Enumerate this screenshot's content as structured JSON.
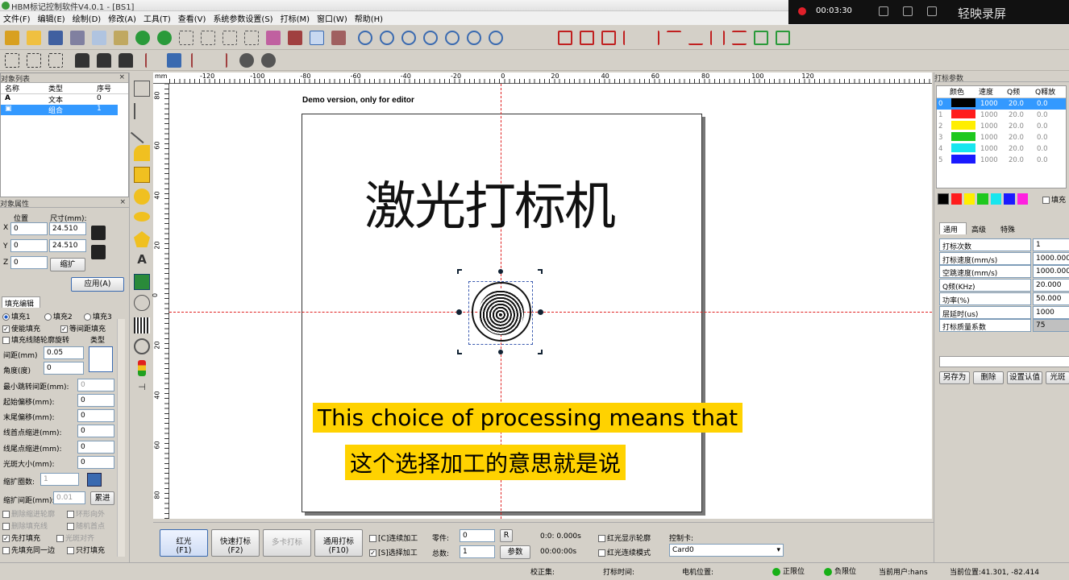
{
  "app": {
    "title": "HBM标记控制软件V4.0.1 - [BS1]"
  },
  "menu": [
    "文件(F)",
    "编辑(E)",
    "绘制(D)",
    "修改(A)",
    "工具(T)",
    "查看(V)",
    "系统参数设置(S)",
    "打标(M)",
    "窗口(W)",
    "帮助(H)"
  ],
  "recorder": {
    "time": "00:03:30",
    "brand": "轻映录屏"
  },
  "object_list": {
    "title": "对象列表",
    "headers": [
      "名称",
      "类型",
      "序号"
    ],
    "rows": [
      {
        "type": "文本",
        "index": "0"
      },
      {
        "type": "组合",
        "index": "1"
      }
    ]
  },
  "object_props": {
    "title": "对象属性",
    "pos_label": "位置",
    "size_label": "尺寸(mm):",
    "x_label": "X",
    "y_label": "Y",
    "z_label": "Z",
    "x": "0",
    "y": "0",
    "z": "0",
    "w": "24.510",
    "h": "24.510",
    "scale_btn": "缩扩",
    "apply_btn": "应用(A)"
  },
  "fill": {
    "tab": "填充编辑",
    "radio1": "填充1",
    "radio2": "填充2",
    "radio3": "填充3",
    "enable": "使能填充",
    "equal": "等间距填充",
    "follow": "填充线随轮廓旋转",
    "type_label": "类型",
    "spacing_label": "间距(mm)",
    "spacing": "0.05",
    "angle_label": "角度(度)",
    "angle": "0",
    "min_jump_label": "最小跳转间距(mm):",
    "min_jump": "0",
    "start_off_label": "起始偏移(mm):",
    "start_off": "0",
    "end_off_label": "末尾偏移(mm):",
    "end_off": "0",
    "line_head_label": "线首点缩进(mm):",
    "line_head": "0",
    "line_tail_label": "线尾点缩进(mm):",
    "line_tail": "0",
    "spot_label": "光斑大小(mm):",
    "spot": "0",
    "expand_count_label": "缩扩圈数:",
    "expand_count": "1",
    "expand_gap_label": "缩扩间距(mm):",
    "expand_gap": "0.01",
    "accum_btn": "累进",
    "del_contour": "删除缩进轮廓",
    "ring_out": "环形向外",
    "del_fill": "删除填充线",
    "random_start": "随机首点",
    "first_fill": "先打填充",
    "spot_align": "光斑对齐",
    "fill_same_side": "先填充同一边",
    "fill_only": "只打填充"
  },
  "ruler": {
    "unit": "mm",
    "h_ticks": [
      "-120",
      "-100",
      "-80",
      "-60",
      "-40",
      "-20",
      "0",
      "20",
      "40",
      "60",
      "80",
      "100",
      "120"
    ],
    "v_ticks": [
      "80",
      "60",
      "40",
      "20",
      "0",
      "20",
      "40",
      "60",
      "80"
    ]
  },
  "canvas": {
    "demo_text": "Demo version, only for editor",
    "big_text": "激光打标机"
  },
  "subtitle": {
    "en": "This choice of processing means that",
    "zh": "这个选择加工的意思就是说"
  },
  "params": {
    "title": "打标参数",
    "headers": [
      "颜色",
      "速度",
      "Q频",
      "Q释放"
    ],
    "rows": [
      {
        "id": "0",
        "color": "#000000",
        "speed": "1000",
        "q": "20.0",
        "qr": "0.0"
      },
      {
        "id": "1",
        "color": "#ff1c1c",
        "speed": "1000",
        "q": "20.0",
        "qr": "0.0"
      },
      {
        "id": "2",
        "color": "#ffee00",
        "speed": "1000",
        "q": "20.0",
        "qr": "0.0"
      },
      {
        "id": "3",
        "color": "#1ec81e",
        "speed": "1000",
        "q": "20.0",
        "qr": "0.0"
      },
      {
        "id": "4",
        "color": "#17e6ee",
        "speed": "1000",
        "q": "20.0",
        "qr": "0.0"
      },
      {
        "id": "5",
        "color": "#1a1aff",
        "speed": "1000",
        "q": "20.0",
        "qr": "0.0"
      }
    ],
    "fill_check": "填充",
    "tabs": [
      "通用",
      "高级",
      "特殊"
    ],
    "fields": [
      {
        "label": "打标次数",
        "value": "1"
      },
      {
        "label": "打标速度(mm/s)",
        "value": "1000.000"
      },
      {
        "label": "空跳速度(mm/s)",
        "value": "1000.000"
      },
      {
        "label": "Q频(KHz)",
        "value": "20.000"
      },
      {
        "label": "功率(%)",
        "value": "50.000"
      },
      {
        "label": "层延时(us)",
        "value": "1000"
      },
      {
        "label": "打标质量系数",
        "value": "75"
      }
    ],
    "buttons": [
      "另存为",
      "删除",
      "设置认值",
      "光斑"
    ]
  },
  "bottom": {
    "red": "红光",
    "red_key": "(F1)",
    "fast": "快速打标",
    "fast_key": "(F2)",
    "multi": "多卡打标",
    "general": "通用打标",
    "general_key": "(F10)",
    "continuous": "[C]连续加工",
    "select": "[S]选择加工",
    "parts_label": "零件:",
    "parts": "0",
    "total_label": "总数:",
    "total": "1",
    "r_btn": "R",
    "param_btn": "参数",
    "time1": "0:0: 0.000s",
    "time2": "00:00:00s",
    "red_contour": "红光显示轮廓",
    "red_cont_mode": "红光连续模式",
    "card_label": "控制卡:",
    "card": "Card0"
  },
  "status": {
    "calib": "校正集:",
    "mark_time": "打标时间:",
    "motor": "电机位置:",
    "pos_limit": "正限位",
    "neg_limit": "负限位",
    "user": "当前用户:hans",
    "cur_pos": "当前位置:41.301, -82.414"
  },
  "colors": {
    "accent": "#3399ff",
    "selection": "#3a7ff0",
    "subtitle_bg": "#ffd200"
  }
}
